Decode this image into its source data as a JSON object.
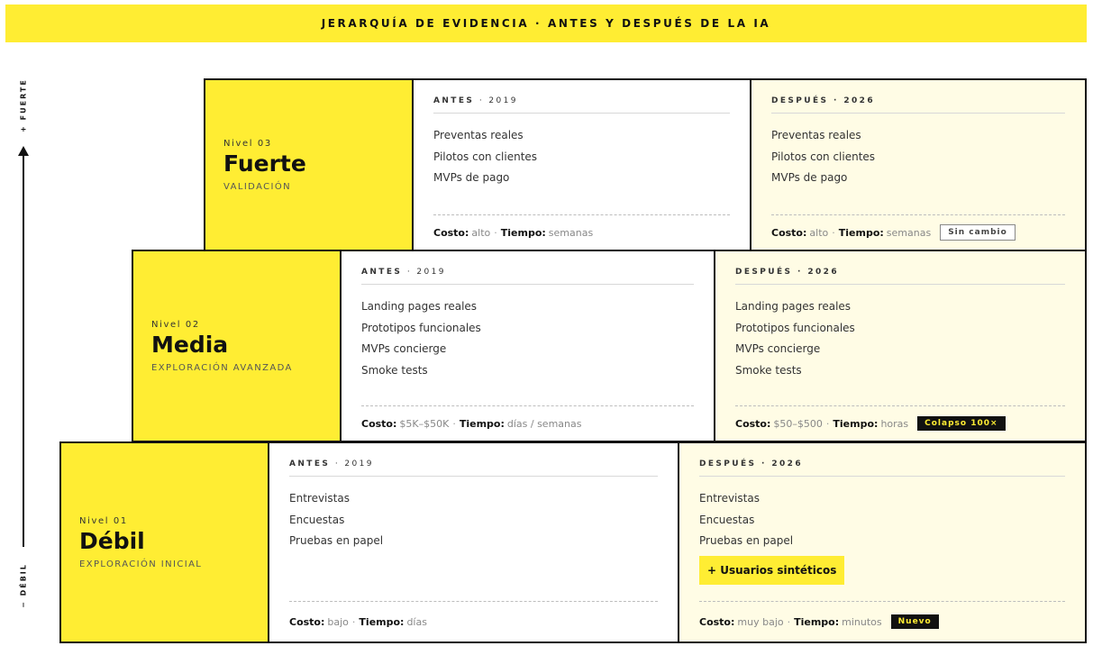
{
  "header": {
    "title": "JERARQUÍA DE EVIDENCIA · ANTES Y DESPUÉS DE LA IA"
  },
  "axis": {
    "top_label": "+ FUERTE",
    "bottom_label": "− DÉBIL"
  },
  "labels": {
    "before_head": "ANTES",
    "before_year": "· 2019",
    "after_head": "DESPUÉS",
    "after_year": "· 2026",
    "cost_key": "Costo:",
    "time_key": "Tiempo:",
    "sep": "·"
  },
  "levels": {
    "fuerte": {
      "kicker": "Nivel 03",
      "name": "Fuerte",
      "subtitle": "VALIDACIÓN",
      "before": {
        "items": [
          "Preventas reales",
          "Pilotos con clientes",
          "MVPs de pago"
        ],
        "cost": "alto",
        "time": "semanas"
      },
      "after": {
        "items": [
          "Preventas reales",
          "Pilotos con clientes",
          "MVPs de pago"
        ],
        "cost": "alto",
        "time": "semanas",
        "badge": "Sin cambio"
      }
    },
    "media": {
      "kicker": "Nivel 02",
      "name": "Media",
      "subtitle": "EXPLORACIÓN AVANZADA",
      "before": {
        "items": [
          "Landing pages reales",
          "Prototipos funcionales",
          "MVPs concierge",
          "Smoke tests"
        ],
        "cost": "$5K–$50K",
        "time": "días / semanas"
      },
      "after": {
        "items": [
          "Landing pages reales",
          "Prototipos funcionales",
          "MVPs concierge",
          "Smoke tests"
        ],
        "cost": "$50–$500",
        "time": "horas",
        "badge": "Colapso 100×"
      }
    },
    "debil": {
      "kicker": "Nivel 01",
      "name": "Débil",
      "subtitle": "EXPLORACIÓN INICIAL",
      "before": {
        "items": [
          "Entrevistas",
          "Encuestas",
          "Pruebas en papel"
        ],
        "cost": "bajo",
        "time": "días"
      },
      "after": {
        "items": [
          "Entrevistas",
          "Encuestas",
          "Pruebas en papel"
        ],
        "highlight": "+ Usuarios sintéticos",
        "cost": "muy bajo",
        "time": "minutos",
        "badge": "Nuevo"
      }
    }
  },
  "colors": {
    "accent": "#ffed33",
    "after_bg": "#fffce5",
    "ink": "#111111"
  }
}
